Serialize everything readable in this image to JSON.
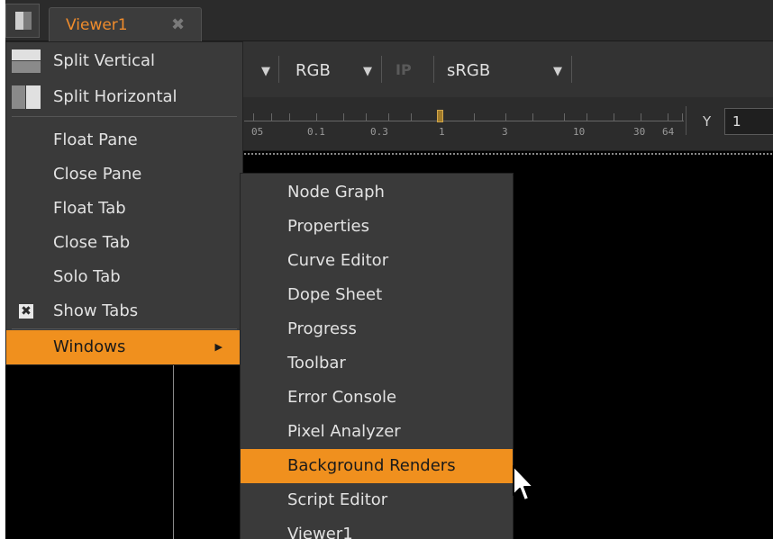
{
  "tabbar": {
    "tab_label": "Viewer1",
    "tab_close_icon": "close-icon"
  },
  "toolbar": {
    "channel_value": "RGB",
    "ip_label": "IP",
    "colorspace_value": "sRGB",
    "y_label": "Y",
    "y_value": "1"
  },
  "ruler": {
    "tick_labels": [
      "05",
      "0.1",
      "0.3",
      "1",
      "3",
      "10",
      "30",
      "64"
    ]
  },
  "pane_menu": {
    "items": [
      {
        "label": "Split Vertical",
        "icon": "split-vertical-icon"
      },
      {
        "label": "Split Horizontal",
        "icon": "split-horizontal-icon"
      },
      {
        "label": "Float Pane"
      },
      {
        "label": "Close Pane"
      },
      {
        "label": "Float Tab"
      },
      {
        "label": "Close Tab"
      },
      {
        "label": "Solo Tab"
      },
      {
        "label": "Show Tabs",
        "icon": "checkbox-checked-icon"
      },
      {
        "label": "Windows",
        "highlighted": true,
        "submenu": true
      }
    ]
  },
  "windows_menu": {
    "items": [
      {
        "label": "Node Graph"
      },
      {
        "label": "Properties"
      },
      {
        "label": "Curve Editor"
      },
      {
        "label": "Dope Sheet"
      },
      {
        "label": "Progress"
      },
      {
        "label": "Toolbar"
      },
      {
        "label": "Error Console"
      },
      {
        "label": "Pixel Analyzer"
      },
      {
        "label": "Background Renders",
        "highlighted": true
      },
      {
        "label": "Script Editor"
      },
      {
        "label": "Viewer1"
      }
    ]
  },
  "colors": {
    "accent": "#f0901e",
    "tab_text": "#f08c2c",
    "menu_bg": "#3a3a3a",
    "viewer_bg": "#000000"
  }
}
